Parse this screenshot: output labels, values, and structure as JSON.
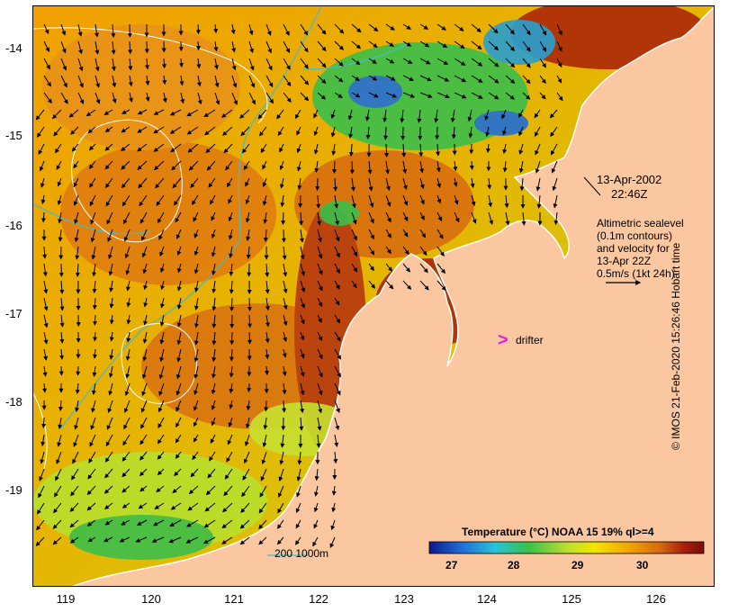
{
  "y_axis": {
    "ticks": [
      "-14",
      "-15",
      "-16",
      "-17",
      "-18",
      "-19"
    ]
  },
  "x_axis": {
    "ticks": [
      "119",
      "120",
      "121",
      "122",
      "123",
      "124",
      "125",
      "126"
    ]
  },
  "annotations": {
    "date": "13-Apr-2002",
    "time": "22:46Z",
    "alt_line1": "Altimetric sealevel",
    "alt_line2": "(0.1m contours)",
    "alt_line3": "and velocity for",
    "alt_line4": "13-Apr 22Z",
    "alt_line5": "0.5m/s (1kt 24h)",
    "drifter_symbol": ">",
    "drifter_label": "drifter",
    "depth_legend": "200  1000m"
  },
  "colorbar": {
    "title": "Temperature (°C) NOAA 15 19% ql>=4",
    "ticks": [
      "27",
      "28",
      "29",
      "30"
    ],
    "colors": [
      "#0a1a8c",
      "#1f6fd6",
      "#29c3d8",
      "#3bbf4a",
      "#b8df2c",
      "#f2e600",
      "#f2a800",
      "#d86a10",
      "#a81e08",
      "#7a1005"
    ]
  },
  "credit": "© IMOS 21-Feb-2020 15:26:46 Hobart time",
  "colors": {
    "land": "#fbc7a0",
    "contour_sealevel": "#ffffff",
    "contour_depth": "#4fb8c0",
    "drifter": "#e020e0"
  }
}
